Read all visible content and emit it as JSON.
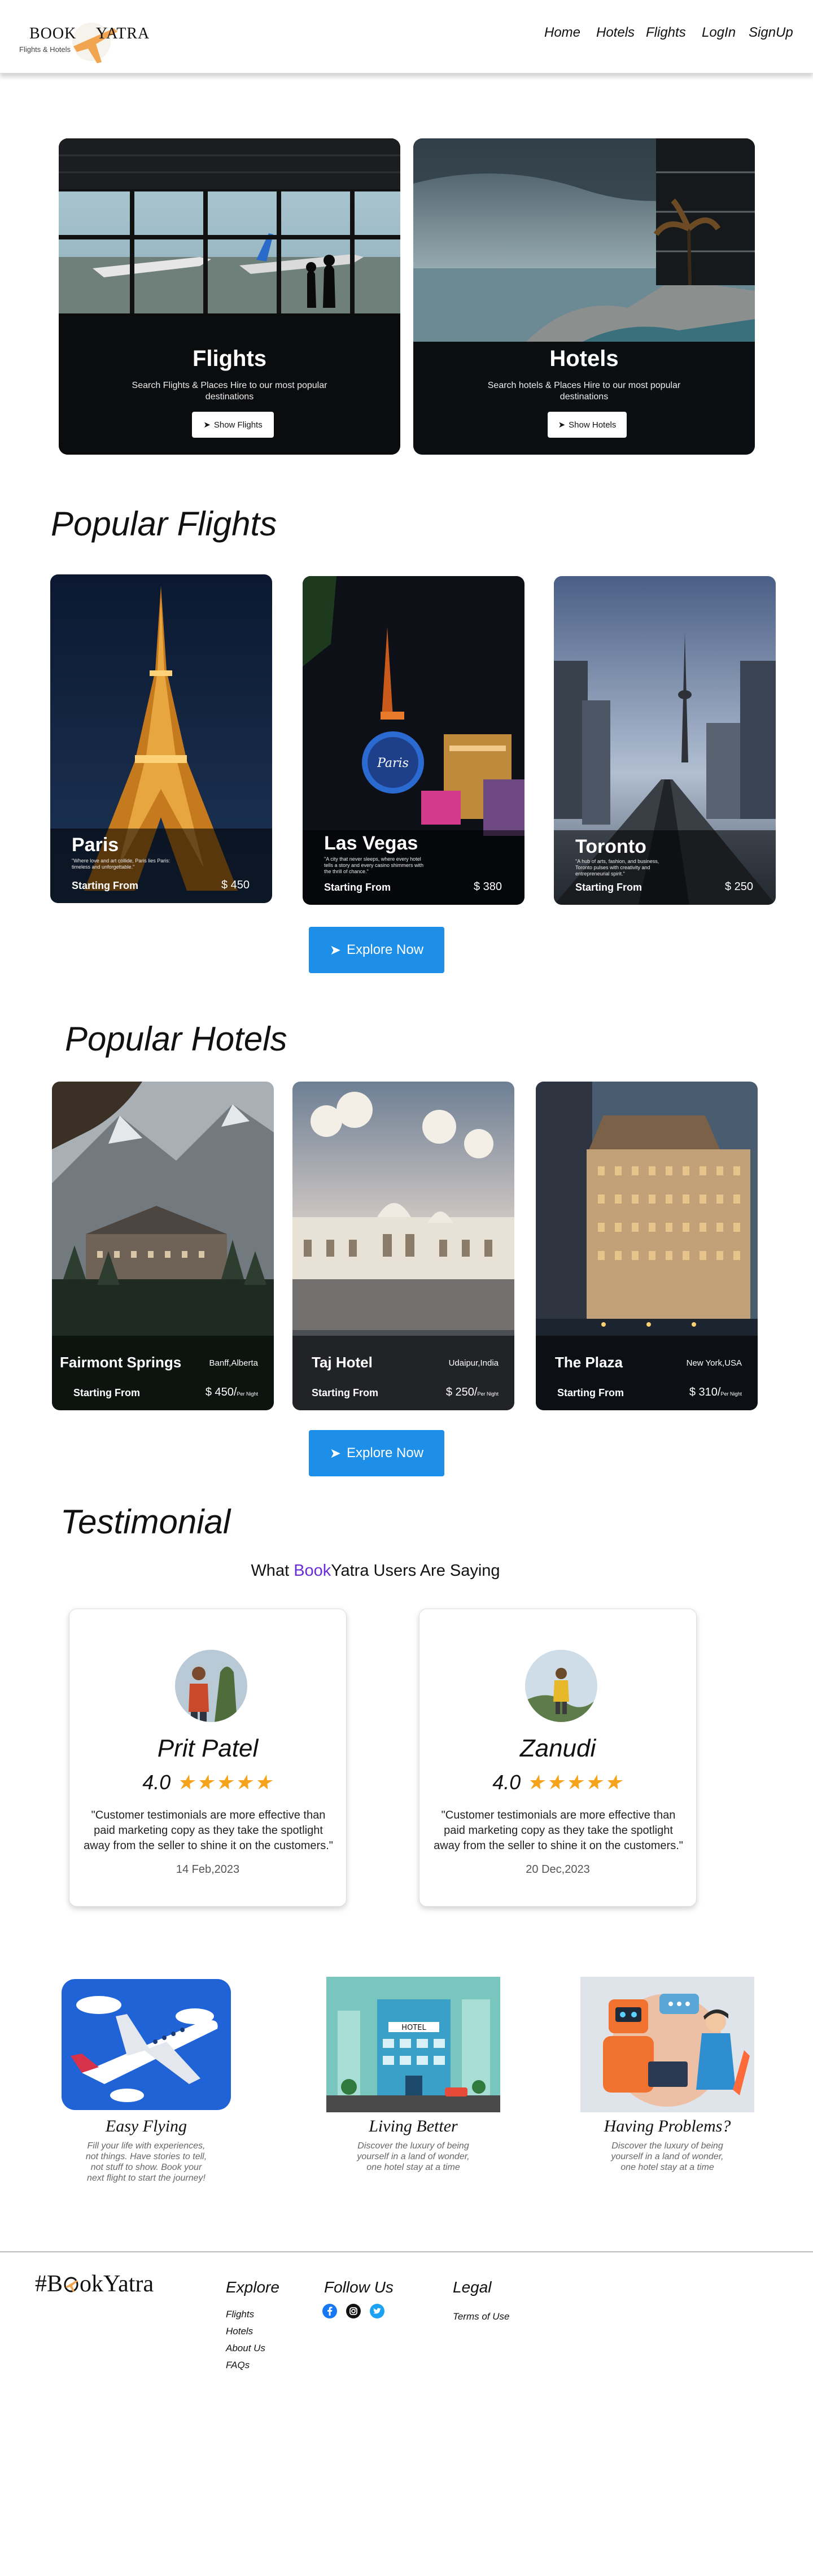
{
  "nav": {
    "logo_text_left": "BOOK",
    "logo_text_right": "YATRA",
    "logo_subtitle": "Flights & Hotels",
    "links": [
      "Home",
      "Hotels",
      "Flights",
      "LogIn",
      "SignUp"
    ]
  },
  "categories": [
    {
      "title": "Flights",
      "subtitle": "Search Flights & Places Hire to our most popular destinations",
      "button": "Show Flights"
    },
    {
      "title": "Hotels",
      "subtitle": "Search hotels & Places Hire to our most popular destinations",
      "button": "Show Hotels"
    }
  ],
  "popular_flights": {
    "heading": "Popular Flights",
    "cards": [
      {
        "name": "Paris",
        "desc": "\"Where love and art collide, Paris lies Paris: timeless and unforgettable.\"",
        "starting": "Starting From",
        "price": "$ 450"
      },
      {
        "name": "Las Vegas",
        "desc": "\"A city that never sleeps, where every hotel tells a story and every casino shimmers with the thrill of chance.\"",
        "starting": "Starting From",
        "price": "$ 380"
      },
      {
        "name": "Toronto",
        "desc": "\"A hub of arts, fashion, and business, Toronto pulses with creativity and entrepreneurial spirit.\"",
        "starting": "Starting From",
        "price": "$ 250"
      }
    ],
    "button": "Explore Now"
  },
  "popular_hotels": {
    "heading": "Popular Hotels",
    "cards": [
      {
        "name": "Fairmont  Springs",
        "location": "Banff,Alberta",
        "starting": "Starting From",
        "price": "$ 450/",
        "per": "Per Night"
      },
      {
        "name": "Taj Hotel",
        "location": "Udaipur,India",
        "starting": "Starting From",
        "price": "$ 250/",
        "per": "Per Night"
      },
      {
        "name": "The Plaza",
        "location": "New York,USA",
        "starting": "Starting From",
        "price": "$ 310/",
        "per": "Per Night"
      }
    ],
    "button": "Explore Now"
  },
  "testimonial": {
    "heading": "Testimonial",
    "sub_prefix": "What ",
    "sub_brand": "Book",
    "sub_suffix": "Yatra Users Are Saying",
    "cards": [
      {
        "name": "Prit Patel",
        "rating": "4.0",
        "stars": "★★★★★",
        "quote": "\"Customer testimonials are more effective than paid marketing copy as they take the spotlight away from the seller to shine it on the customers.\"",
        "date": "14 Feb,2023"
      },
      {
        "name": "Zanudi",
        "rating": "4.0",
        "stars": "★★★★★",
        "quote": "\"Customer testimonials are more effective than paid marketing copy as they take the spotlight away from the seller to shine it on the customers.\"",
        "date": "20 Dec,2023"
      }
    ]
  },
  "features": [
    {
      "title": "Easy Flying",
      "desc": "Fill your life with experiences, not things. Have stories to tell, not stuff to show. Book your next flight to start the journey!"
    },
    {
      "title": "Living Better",
      "desc": "Discover the luxury of being yourself in a land of wonder, one hotel stay at a time"
    },
    {
      "title": "Having Problems?",
      "desc": "Discover the luxury of being yourself in a land of wonder, one hotel stay at a time"
    }
  ],
  "footer": {
    "brand_prefix": "#B",
    "brand_rest": "kYatra",
    "explore_heading": "Explore",
    "explore_links": [
      "Flights",
      "Hotels",
      "About Us",
      "FAQs"
    ],
    "follow_heading": "Follow Us",
    "legal_heading": "Legal",
    "legal_links": [
      "Terms of Use"
    ]
  },
  "colors": {
    "accent_blue": "#1e8fe8",
    "brand_purple": "#6a2bd9",
    "star_orange": "#f5a31a",
    "logo_plane": "#f2a550"
  }
}
